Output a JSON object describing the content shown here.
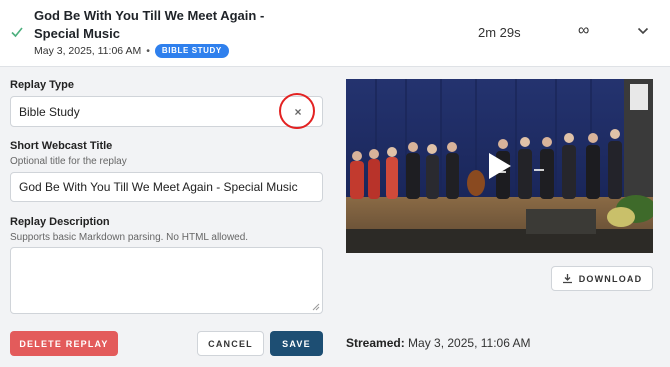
{
  "header": {
    "title": "God Be With You Till We Meet Again - Special Music",
    "date": "May 3, 2025, 11:06 AM",
    "separator": "•",
    "badge": "BIBLE STUDY",
    "duration": "2m 29s",
    "views": "∞",
    "icons": {
      "status": "check-icon",
      "expand": "chevron-down-icon"
    }
  },
  "form": {
    "replay_type": {
      "label": "Replay Type",
      "value": "Bible Study",
      "clear_glyph": "×"
    },
    "short_title": {
      "label": "Short Webcast Title",
      "hint": "Optional title for the replay",
      "value": "God Be With You Till We Meet Again - Special Music"
    },
    "description": {
      "label": "Replay Description",
      "hint": "Supports basic Markdown parsing. No HTML allowed.",
      "value": ""
    }
  },
  "buttons": {
    "delete": "DELETE REPLAY",
    "cancel": "CANCEL",
    "save": "SAVE",
    "download": "DOWNLOAD"
  },
  "video": {
    "play_icon": "play-icon"
  },
  "streamed": {
    "label": "Streamed:",
    "value": "May 3, 2025, 11:06 AM"
  },
  "colors": {
    "accent": "#2f80ed",
    "danger": "#e35b5b",
    "primary": "#1d4e73",
    "highlight": "#e32222",
    "success": "#4caf7d"
  }
}
